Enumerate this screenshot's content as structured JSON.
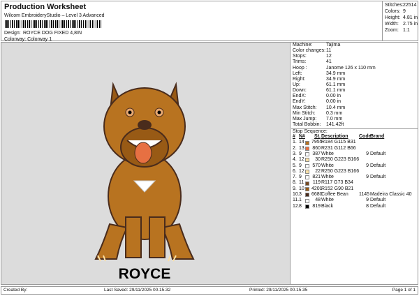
{
  "header": {
    "title": "Production Worksheet",
    "subtitle": "Wilcom EmbroideryStudio – Level 3 Advanced",
    "design_label": "Design:",
    "design_value": "ROYCE DOG FIXED 4,8IN",
    "colorway_label": "Colorway:",
    "colorway_value": "Colorway 1"
  },
  "stats": [
    {
      "k": "Stitches:",
      "v": "22514"
    },
    {
      "k": "Colors:",
      "v": "9"
    },
    {
      "k": "Height:",
      "v": "4.81 in"
    },
    {
      "k": "Width:",
      "v": "2.75 in"
    },
    {
      "k": "Zoom:",
      "v": "1:1"
    }
  ],
  "design_text": "ROYCE",
  "info": [
    {
      "k": "Machine:",
      "v": "Tajima"
    },
    {
      "k": "Color changes:",
      "v": "11"
    },
    {
      "k": "Stops:",
      "v": "12"
    },
    {
      "k": "Trims:",
      "v": "41"
    },
    {
      "k": "Hoop :",
      "v": "Janome 126 x 110 mm"
    },
    {
      "k": "Left:",
      "v": "34.9 mm"
    },
    {
      "k": "Right:",
      "v": "34.9 mm"
    },
    {
      "k": "Up:",
      "v": "61.1 mm"
    },
    {
      "k": "Down:",
      "v": "61.1 mm"
    },
    {
      "k": "EndX:",
      "v": "0.00 in"
    },
    {
      "k": "EndY:",
      "v": "0.00 in"
    },
    {
      "k": "Max Stitch:",
      "v": "10.4 mm"
    },
    {
      "k": "Min Stitch:",
      "v": "0.3 mm"
    },
    {
      "k": "Max Jump:",
      "v": "7.0 mm"
    },
    {
      "k": "Total Bobbin:",
      "v": "141.42ft"
    }
  ],
  "stop_sequence": {
    "title": "Stop Sequence:",
    "headers": [
      "#",
      "N#",
      "St.",
      "Description",
      "Code",
      "Brand"
    ],
    "rows": [
      {
        "n": "1.",
        "nn": "14",
        "color": "#b87320",
        "st": "7955",
        "desc": "R184 G115 B31",
        "code": "",
        "brand": ""
      },
      {
        "n": "2.",
        "nn": "13",
        "color": "#e77042",
        "st": "860",
        "desc": "R231 G112 B66",
        "code": "",
        "brand": ""
      },
      {
        "n": "3.",
        "nn": "9",
        "color": "#ffffff",
        "st": "387",
        "desc": "White",
        "code": "9",
        "brand": "Default"
      },
      {
        "n": "4.",
        "nn": "12",
        "color": "#fadfa6",
        "st": "30",
        "desc": "R250 G223 B166",
        "code": "",
        "brand": ""
      },
      {
        "n": "5.",
        "nn": "9",
        "color": "#ffffff",
        "st": "570",
        "desc": "White",
        "code": "9",
        "brand": "Default"
      },
      {
        "n": "6.",
        "nn": "12",
        "color": "#fadfa6",
        "st": "22",
        "desc": "R250 G223 B166",
        "code": "",
        "brand": ""
      },
      {
        "n": "7.",
        "nn": "9",
        "color": "#ffffff",
        "st": "821",
        "desc": "White",
        "code": "9",
        "brand": "Default"
      },
      {
        "n": "8.",
        "nn": "11",
        "color": "#754922",
        "st": "119",
        "desc": "R117 G73 B34",
        "code": "",
        "brand": ""
      },
      {
        "n": "9.",
        "nn": "10",
        "color": "#985a15",
        "st": "4201",
        "desc": "R152 G90 B21",
        "code": "",
        "brand": ""
      },
      {
        "n": "10.",
        "nn": "3",
        "color": "#4a2c1c",
        "st": "6680",
        "desc": "Coffee Bean",
        "code": "1145",
        "brand": "Madeira Classic 40"
      },
      {
        "n": "11.",
        "nn": "1",
        "color": "#ffffff",
        "st": "48",
        "desc": "White",
        "code": "9",
        "brand": "Default"
      },
      {
        "n": "12.",
        "nn": "8",
        "color": "#000000",
        "st": "819",
        "desc": "Black",
        "code": "8",
        "brand": "Default"
      }
    ]
  },
  "footer": {
    "created": "Created By:",
    "saved": "Last Saved: 29/11/2025 00.15.32",
    "printed": "Printed: 29/11/2025 00.15.35",
    "page": "Page 1 of 1"
  }
}
